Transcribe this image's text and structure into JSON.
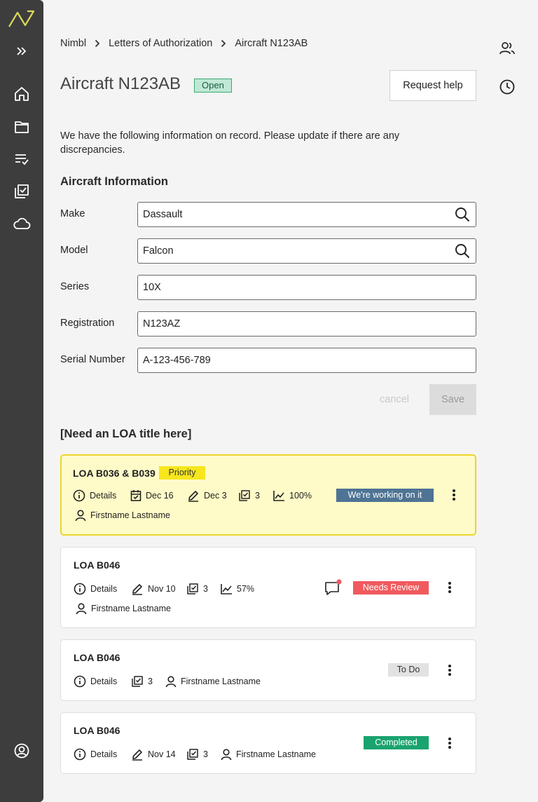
{
  "app": {
    "name": "Nimbl"
  },
  "sidebar": {
    "items": [
      {
        "icon": "expand-icon"
      },
      {
        "icon": "home-icon"
      },
      {
        "icon": "folder-icon"
      },
      {
        "icon": "tasks-list-icon"
      },
      {
        "icon": "checklist-icon"
      },
      {
        "icon": "cloud-icon"
      }
    ],
    "bottom_icon": "account-icon"
  },
  "breadcrumb": [
    "Nimbl",
    "Letters of Authorization",
    "Aircraft N123AB"
  ],
  "right_rail": [
    "people-icon",
    "history-icon"
  ],
  "page": {
    "title": "Aircraft N123AB",
    "status": "Open",
    "help_label": "Request help",
    "intro": "We have the following information on record. Please update if there are any discrepancies.",
    "section_title": "Aircraft Information"
  },
  "form": {
    "fields": [
      {
        "label": "Make",
        "value": "Dassault",
        "search": true
      },
      {
        "label": "Model",
        "value": "Falcon",
        "search": true
      },
      {
        "label": "Series",
        "value": "10X",
        "search": false
      },
      {
        "label": "Registration",
        "value": "N123AZ",
        "search": false
      },
      {
        "label": "Serial Number",
        "value": "A-123-456-789",
        "search": false
      }
    ],
    "cancel_label": "cancel",
    "save_label": "Save"
  },
  "loa_section": {
    "heading": "[Need an LOA title here]"
  },
  "cards": [
    {
      "title": "LOA B036 & B039",
      "priority_label": "Priority",
      "details": "Details",
      "due": "Dec 16",
      "edited": "Dec 3",
      "tasks": "3",
      "progress": "100%",
      "assignee": "Firstname Lastname",
      "status": "We're working on it",
      "status_color": "#4e7394"
    },
    {
      "title": "LOA B046",
      "details": "Details",
      "edited": "Nov 10",
      "tasks": "3",
      "progress": "57%",
      "assignee": "Firstname Lastname",
      "status": "Needs Review",
      "status_color": "#f05a5e",
      "has_comment_notification": true
    },
    {
      "title": "LOA B046",
      "details": "Details",
      "tasks": "3",
      "assignee": "Firstname Lastname",
      "status": "To Do",
      "status_color": "#e2e2e2"
    },
    {
      "title": "LOA B046",
      "details": "Details",
      "edited": "Nov 14",
      "tasks": "3",
      "assignee": "Firstname Lastname",
      "status": "Completed",
      "status_color": "#1aa36f"
    }
  ],
  "colors": {
    "sidebar": "#3d3d3d",
    "logo": "#d9d95a",
    "priority_card_bg": "#fffbc8",
    "priority_card_border": "#ecd52b",
    "priority_badge": "#f7e61e",
    "open_badge": "#bfe9d6"
  }
}
